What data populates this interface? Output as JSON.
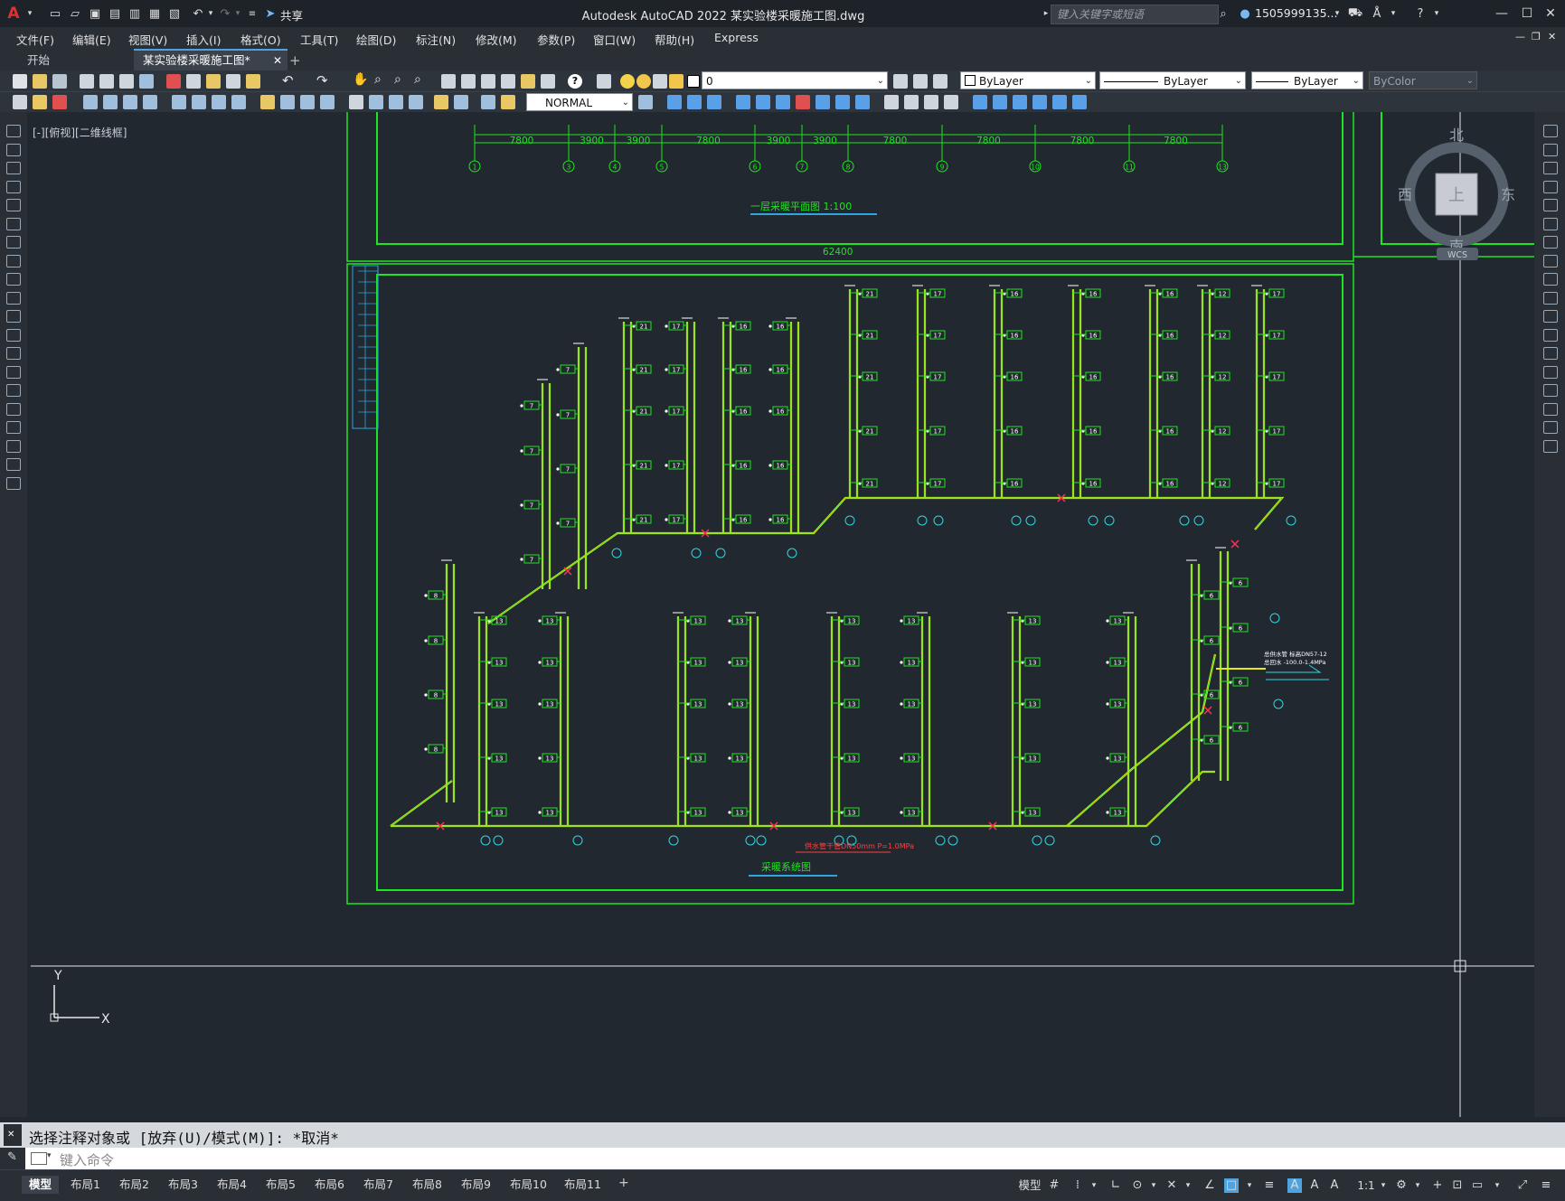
{
  "app": {
    "title": "Autodesk AutoCAD 2022    某实验楼采暖施工图.dwg",
    "share_label": "共享",
    "search_placeholder": "键入关键字或短语",
    "user": "1505999135...",
    "help_glyph": "?"
  },
  "menu": [
    "文件(F)",
    "编辑(E)",
    "视图(V)",
    "插入(I)",
    "格式(O)",
    "工具(T)",
    "绘图(D)",
    "标注(N)",
    "修改(M)",
    "参数(P)",
    "窗口(W)",
    "帮助(H)",
    "Express"
  ],
  "tabs": [
    {
      "label": "开始",
      "active": false
    },
    {
      "label": "某实验楼采暖施工图*",
      "active": true
    }
  ],
  "properties": {
    "layer": "0",
    "color": "ByLayer",
    "linetype": "ByLayer",
    "lineweight": "ByLayer",
    "plotstyle": "ByColor",
    "dimstyle": "NORMAL"
  },
  "viewport_label": "[-][俯视][二维线框]",
  "viewcube": {
    "north": "北",
    "south": "南",
    "east": "东",
    "west": "西",
    "face": "上",
    "wcs": "WCS"
  },
  "drawing": {
    "top_dims": [
      "7800",
      "3900",
      "3900",
      "7800",
      "3900",
      "3900",
      "7800",
      "7800",
      "7800",
      "7800"
    ],
    "top_total": "62400",
    "axis_numbers": [
      "1",
      "3",
      "4",
      "5",
      "6",
      "7",
      "8",
      "9",
      "10",
      "11",
      "13"
    ],
    "plan_title": "一层采暖平面图  1:100",
    "system_title": "采暖系统图",
    "note_main": "供水管干管DN50mm P=1.0MPa",
    "note_right_1": "总供水管 标高DN57-12",
    "note_right_2": "总回水 -100.0-1.4MPa",
    "radiator_values_upper": [
      "21",
      "17",
      "16",
      "16",
      "16",
      "12",
      "17",
      "21"
    ],
    "radiator_values_lower": [
      "13",
      "13",
      "13",
      "13",
      "13",
      "13",
      "13",
      "13"
    ],
    "ucs_x": "X",
    "ucs_y": "Y"
  },
  "command": {
    "history": "选择注释对象或 [放弃(U)/模式(M)]: *取消*",
    "placeholder": "键入命令"
  },
  "layouts": [
    "模型",
    "布局1",
    "布局2",
    "布局3",
    "布局4",
    "布局5",
    "布局6",
    "布局7",
    "布局8",
    "布局9",
    "布局10",
    "布局11"
  ],
  "status": {
    "model_label": "模型",
    "scale": "1:1"
  }
}
